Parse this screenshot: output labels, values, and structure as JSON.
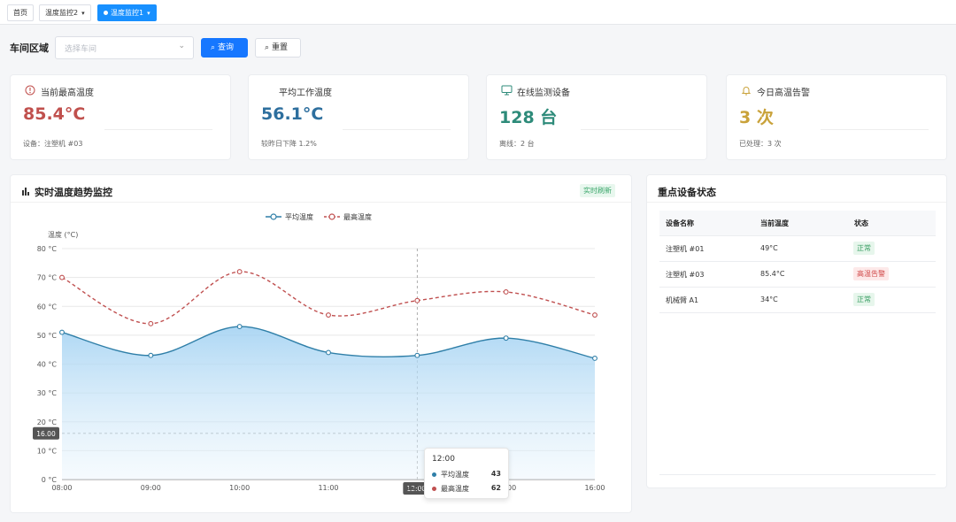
{
  "tabs": [
    {
      "label": "首页"
    },
    {
      "label": "温度监控2"
    },
    {
      "label": "温度监控1"
    }
  ],
  "filter": {
    "label": "车间区域",
    "placeholder": "选择车间",
    "query_label": "查询",
    "reset_label": "重置"
  },
  "cards": [
    {
      "title": "当前最高温度",
      "value": "85.4°C",
      "sub": "设备：注塑机 #03",
      "icon": "alert-circle-icon",
      "color": "#c0504d"
    },
    {
      "title": "平均工作温度",
      "value": "56.1°C",
      "sub": "较昨日下降 1.2%",
      "icon": "none",
      "color": "#2e6f9e"
    },
    {
      "title": "在线监测设备",
      "value": "128 台",
      "sub": "离线：2 台",
      "icon": "monitor-icon",
      "color": "#2e8b7a"
    },
    {
      "title": "今日高温告警",
      "value": "3 次",
      "sub": "已处理：3 次",
      "icon": "bell-icon",
      "color": "#c9a23a"
    }
  ],
  "chart_panel": {
    "title": "实时温度趋势监控",
    "badge": "实时刷新"
  },
  "chart_data": {
    "type": "line",
    "ylabel": "温度 (°C)",
    "ylim": [
      0,
      80
    ],
    "yticks": [
      "0 °C",
      "10 °C",
      "20 °C",
      "30 °C",
      "40 °C",
      "50 °C",
      "60 °C",
      "70 °C",
      "80 °C"
    ],
    "categories": [
      "08:00",
      "09:00",
      "10:00",
      "11:00",
      "12:00",
      "13:00",
      "16:00"
    ],
    "series": [
      {
        "name": "平均温度",
        "values": [
          51,
          43,
          53,
          44,
          43,
          49,
          42
        ],
        "color": "#2f7fa8",
        "area": true
      },
      {
        "name": "最高温度",
        "values": [
          70,
          54,
          72,
          57,
          62,
          65,
          57
        ],
        "color": "#c05050",
        "dashed": true
      }
    ],
    "crosshair": {
      "x_label": "12:00",
      "y_label": "16.00"
    },
    "legend": "top-center",
    "grid": true
  },
  "tooltip": {
    "time": "12:00",
    "rows": [
      {
        "name": "平均温度",
        "value": "43",
        "color": "#2f7fa8"
      },
      {
        "name": "最高温度",
        "value": "62",
        "color": "#c05050"
      }
    ]
  },
  "status_panel": {
    "title": "重点设备状态",
    "columns": [
      "设备名称",
      "当前温度",
      "状态"
    ],
    "rows": [
      {
        "name": "注塑机 #01",
        "temp": "49°C",
        "status": "正常",
        "level": "ok"
      },
      {
        "name": "注塑机 #03",
        "temp": "85.4°C",
        "status": "高温告警",
        "level": "warn"
      },
      {
        "name": "机械臂 A1",
        "temp": "34°C",
        "status": "正常",
        "level": "ok"
      }
    ]
  }
}
